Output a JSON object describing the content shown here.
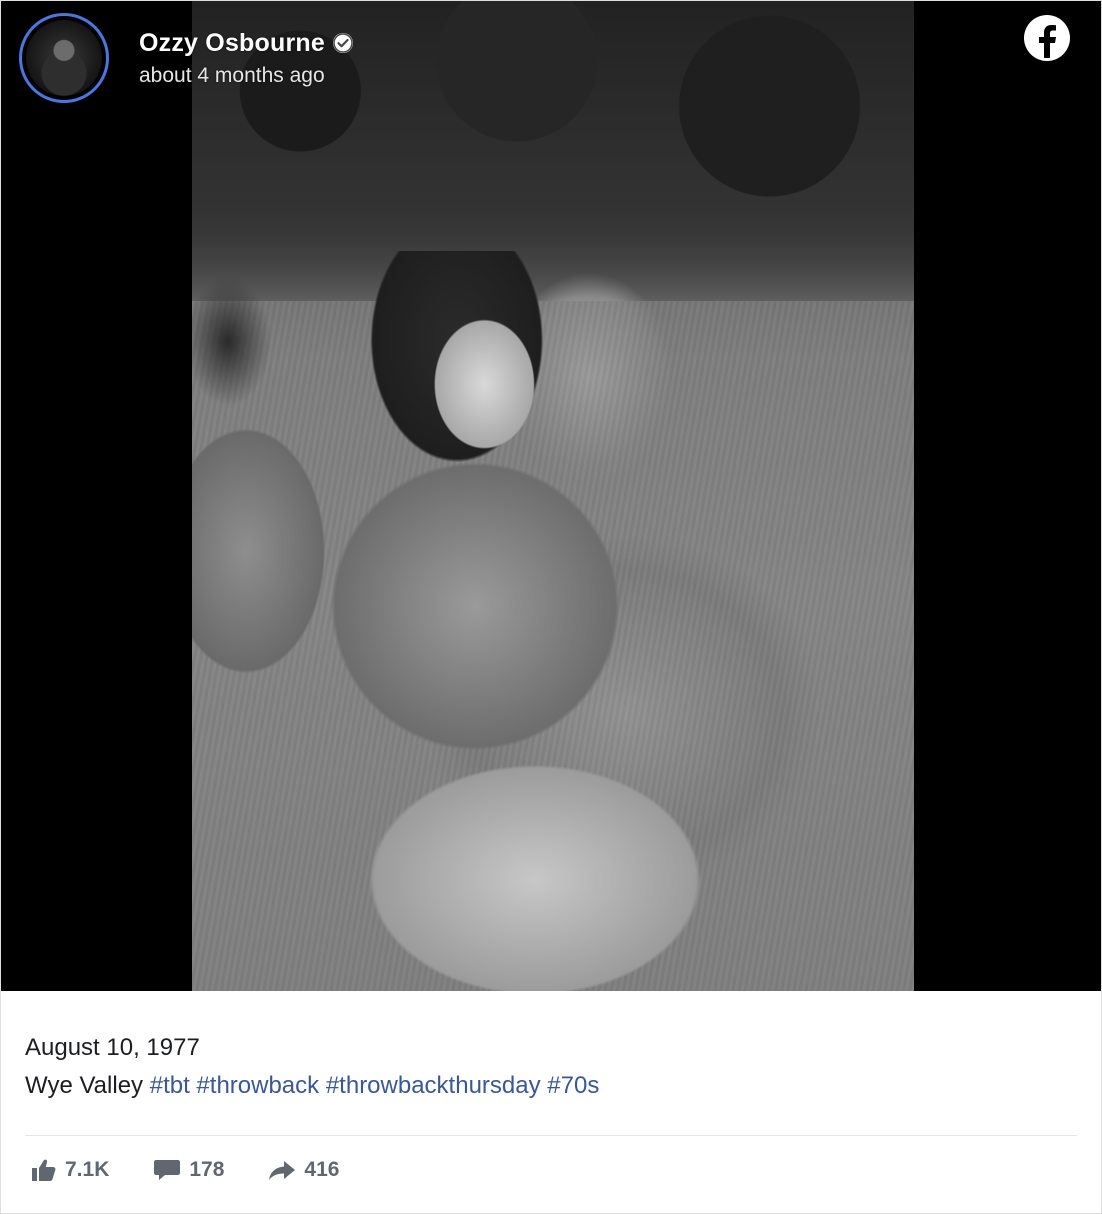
{
  "post": {
    "author": "Ozzy Osbourne",
    "timestamp": "about 4 months ago",
    "caption": {
      "line1": "August 10, 1977",
      "location": "Wye Valley",
      "hashtags": [
        "#tbt",
        "#throwback",
        "#throwbackthursday",
        "#70s"
      ]
    }
  },
  "stats": {
    "likes": "7.1K",
    "comments": "178",
    "shares": "416"
  },
  "icons": {
    "platform": "facebook-icon",
    "verified": "verified-badge-icon",
    "like": "thumbs-up-icon",
    "comment": "comment-icon",
    "share": "share-arrow-icon"
  },
  "colors": {
    "avatar_ring": "#4a76e0",
    "hashtag": "#385898",
    "stats_text": "#606770"
  }
}
